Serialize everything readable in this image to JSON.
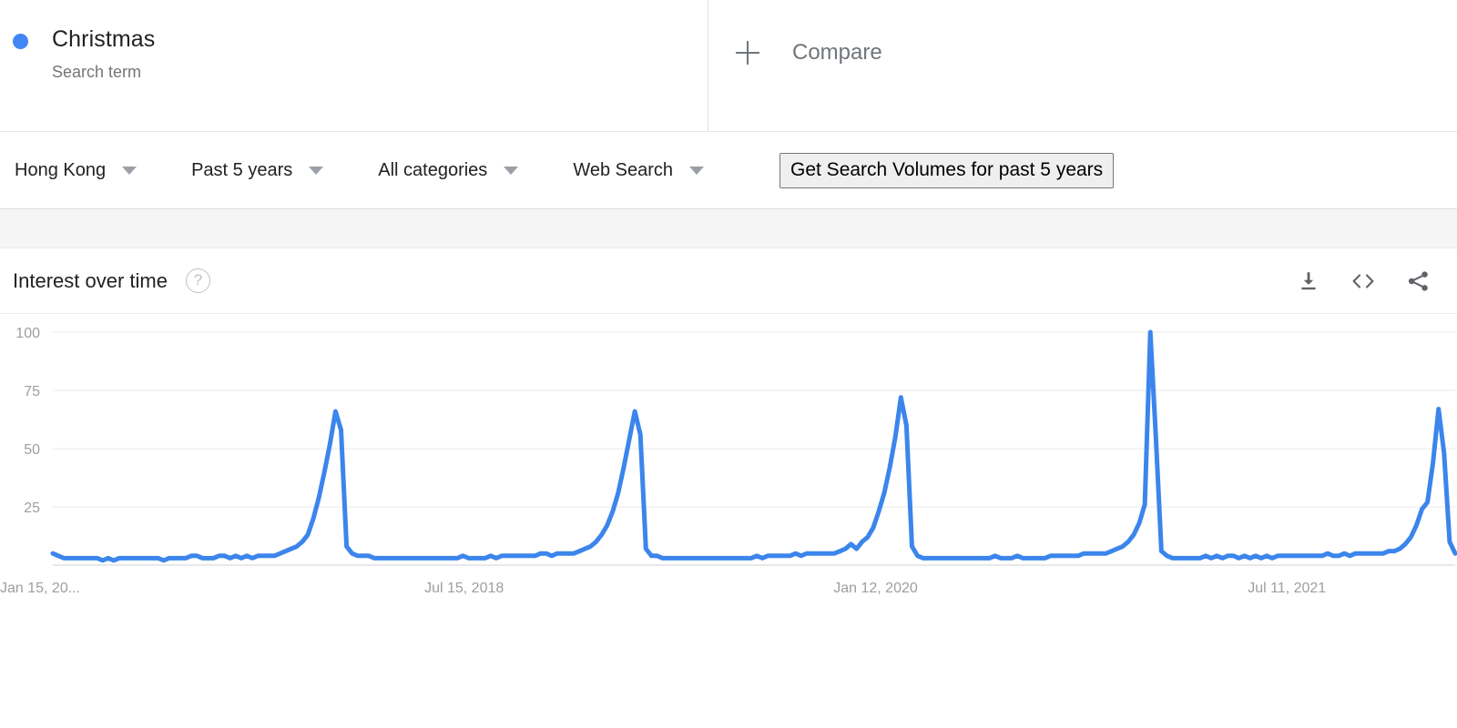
{
  "term": {
    "dot_color": "#4285f4",
    "title": "Christmas",
    "subtitle": "Search term"
  },
  "compare": {
    "icon": "plus-icon",
    "label": "Compare"
  },
  "filters": [
    {
      "label": "Hong Kong"
    },
    {
      "label": "Past 5 years"
    },
    {
      "label": "All categories"
    },
    {
      "label": "Web Search"
    }
  ],
  "actions": {
    "get_volumes_label": "Get Search Volumes for past 5 years"
  },
  "card": {
    "title": "Interest over time",
    "help_glyph": "?",
    "icons": [
      {
        "name": "download-icon"
      },
      {
        "name": "embed-code-icon"
      },
      {
        "name": "share-icon"
      }
    ]
  },
  "chart_data": {
    "type": "line",
    "title": "Interest over time",
    "xlabel": "",
    "ylabel": "",
    "ylim": [
      0,
      100
    ],
    "yticks": [
      25,
      50,
      75,
      100
    ],
    "grid": true,
    "legend_position": "top",
    "line_color": "#3b85ec",
    "x_tick_labels": [
      "Jan 15, 20...",
      "Jul 15, 2018",
      "Jan 12, 2020",
      "Jul 11, 2021"
    ],
    "x_tick_positions": [
      0,
      0.2933,
      0.5867,
      0.88
    ],
    "series": [
      {
        "name": "Christmas",
        "color": "#3b85ec",
        "values": [
          5,
          4,
          3,
          3,
          3,
          3,
          3,
          3,
          3,
          2,
          3,
          2,
          3,
          3,
          3,
          3,
          3,
          3,
          3,
          3,
          2,
          3,
          3,
          3,
          3,
          4,
          4,
          3,
          3,
          3,
          4,
          4,
          3,
          4,
          3,
          4,
          3,
          4,
          4,
          4,
          4,
          5,
          6,
          7,
          8,
          10,
          13,
          20,
          29,
          40,
          52,
          66,
          58,
          8,
          5,
          4,
          4,
          4,
          3,
          3,
          3,
          3,
          3,
          3,
          3,
          3,
          3,
          3,
          3,
          3,
          3,
          3,
          3,
          3,
          4,
          3,
          3,
          3,
          3,
          4,
          3,
          4,
          4,
          4,
          4,
          4,
          4,
          4,
          5,
          5,
          4,
          5,
          5,
          5,
          5,
          6,
          7,
          8,
          10,
          13,
          17,
          23,
          31,
          42,
          54,
          66,
          56,
          7,
          4,
          4,
          3,
          3,
          3,
          3,
          3,
          3,
          3,
          3,
          3,
          3,
          3,
          3,
          3,
          3,
          3,
          3,
          3,
          4,
          3,
          4,
          4,
          4,
          4,
          4,
          5,
          4,
          5,
          5,
          5,
          5,
          5,
          5,
          6,
          7,
          9,
          7,
          10,
          12,
          16,
          23,
          31,
          42,
          55,
          72,
          60,
          8,
          4,
          3,
          3,
          3,
          3,
          3,
          3,
          3,
          3,
          3,
          3,
          3,
          3,
          3,
          4,
          3,
          3,
          3,
          4,
          3,
          3,
          3,
          3,
          3,
          4,
          4,
          4,
          4,
          4,
          4,
          5,
          5,
          5,
          5,
          5,
          6,
          7,
          8,
          10,
          13,
          18,
          26,
          100,
          55,
          6,
          4,
          3,
          3,
          3,
          3,
          3,
          3,
          4,
          3,
          4,
          3,
          4,
          4,
          3,
          4,
          3,
          4,
          3,
          4,
          3,
          4,
          4,
          4,
          4,
          4,
          4,
          4,
          4,
          4,
          5,
          4,
          4,
          5,
          4,
          5,
          5,
          5,
          5,
          5,
          5,
          6,
          6,
          7,
          9,
          12,
          17,
          24,
          27,
          44,
          67,
          48,
          10,
          5
        ]
      }
    ]
  }
}
